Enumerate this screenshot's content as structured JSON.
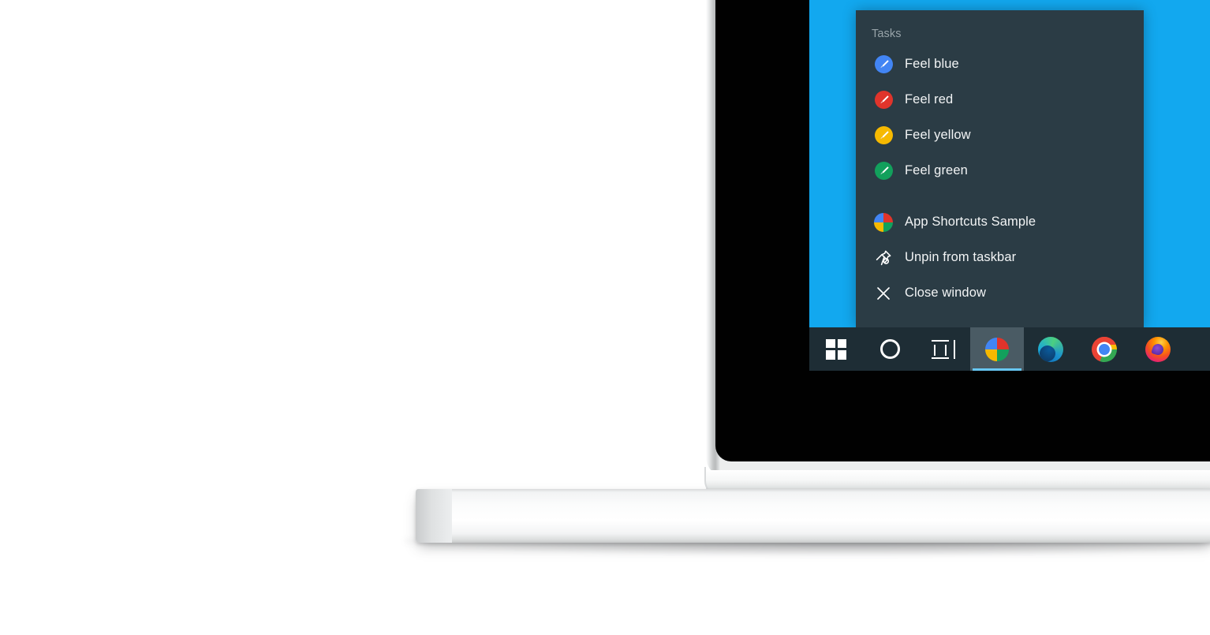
{
  "scene": {
    "device": "laptop-mockup",
    "background_color": "#ffffff",
    "desktop_wallpaper_color": "#12a8ef",
    "taskbar_color": "#1e2d35",
    "menu_background_color": "#2b3c45",
    "menu_text_color": "#f2f4f5",
    "menu_header_color": "#98a4a9",
    "active_indicator_color": "#67c7f5"
  },
  "jumplist": {
    "header": "Tasks",
    "tasks": [
      {
        "label": "Feel blue",
        "icon": "brush-blue-icon",
        "color": "#4285f4"
      },
      {
        "label": "Feel red",
        "icon": "brush-red-icon",
        "color": "#e0342b"
      },
      {
        "label": "Feel yellow",
        "icon": "brush-yellow-icon",
        "color": "#f6b900"
      },
      {
        "label": "Feel green",
        "icon": "brush-green-icon",
        "color": "#12a05c"
      }
    ],
    "actions": [
      {
        "label": "App Shortcuts Sample",
        "icon": "app-quadrant-icon"
      },
      {
        "label": "Unpin from taskbar",
        "icon": "unpin-icon"
      },
      {
        "label": "Close window",
        "icon": "close-icon"
      }
    ]
  },
  "taskbar": {
    "items": [
      {
        "name": "start-button",
        "icon": "windows-logo-icon",
        "label": "Start",
        "active": false
      },
      {
        "name": "cortana-button",
        "icon": "cortana-circle-icon",
        "label": "Cortana",
        "active": false
      },
      {
        "name": "task-view-button",
        "icon": "task-view-icon",
        "label": "Task View",
        "active": false
      },
      {
        "name": "app-shortcuts-sample-button",
        "icon": "app-quadrant-icon",
        "label": "App Shortcuts Sample",
        "active": true
      },
      {
        "name": "edge-button",
        "icon": "edge-icon",
        "label": "Microsoft Edge",
        "active": false
      },
      {
        "name": "chrome-button",
        "icon": "chrome-icon",
        "label": "Google Chrome",
        "active": false
      },
      {
        "name": "firefox-button",
        "icon": "firefox-icon",
        "label": "Mozilla Firefox",
        "active": false
      }
    ]
  },
  "app_icon_quadrants": {
    "top_left": "#4285f4",
    "top_right": "#e0342b",
    "bottom_left": "#f6b900",
    "bottom_right": "#12a05c"
  }
}
